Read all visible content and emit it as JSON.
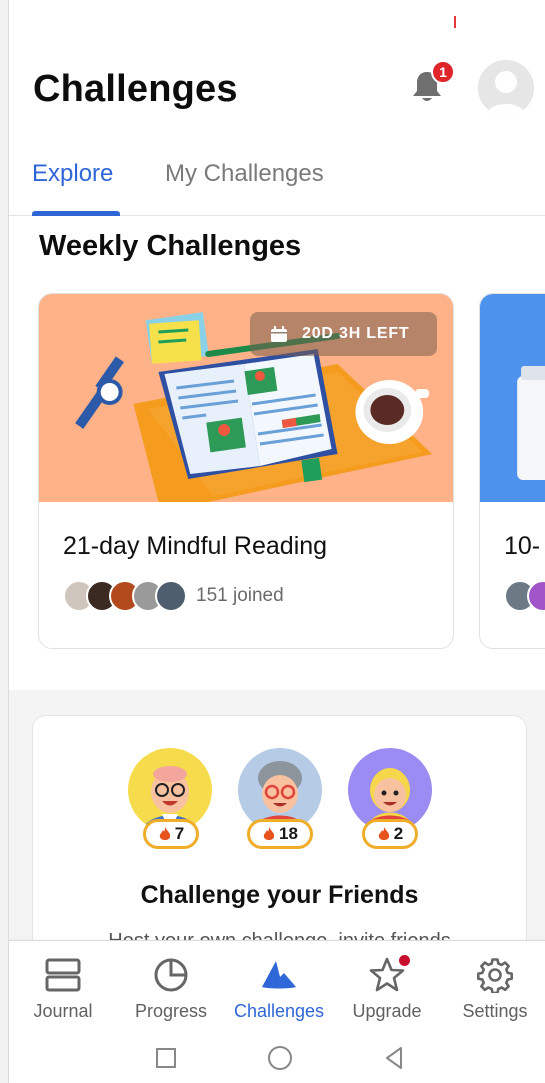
{
  "header": {
    "title": "Challenges",
    "notification_count": "1"
  },
  "tabs": [
    {
      "label": "Explore",
      "active": true
    },
    {
      "label": "My Challenges",
      "active": false
    }
  ],
  "weekly": {
    "title": "Weekly Challenges",
    "cards": [
      {
        "title": "21-day Mindful Reading",
        "timer": "20D 3H LEFT",
        "joined": "151 joined",
        "image": "open-book-illustration"
      },
      {
        "title": "10-",
        "image": "water-bottle-illustration"
      }
    ]
  },
  "friends": {
    "title": "Challenge your Friends",
    "subtitle": "Host your own challenge, invite friends",
    "streaks": [
      "7",
      "18",
      "2"
    ]
  },
  "bottom_nav": [
    {
      "label": "Journal",
      "icon": "journal-icon"
    },
    {
      "label": "Progress",
      "icon": "progress-icon"
    },
    {
      "label": "Challenges",
      "icon": "challenges-icon",
      "active": true
    },
    {
      "label": "Upgrade",
      "icon": "star-icon"
    },
    {
      "label": "Settings",
      "icon": "gear-icon"
    }
  ],
  "colors": {
    "accent": "#2f66d8",
    "badge": "#e0252a",
    "streak_border": "#f0ad2a",
    "card_orange": "#ffb287"
  }
}
